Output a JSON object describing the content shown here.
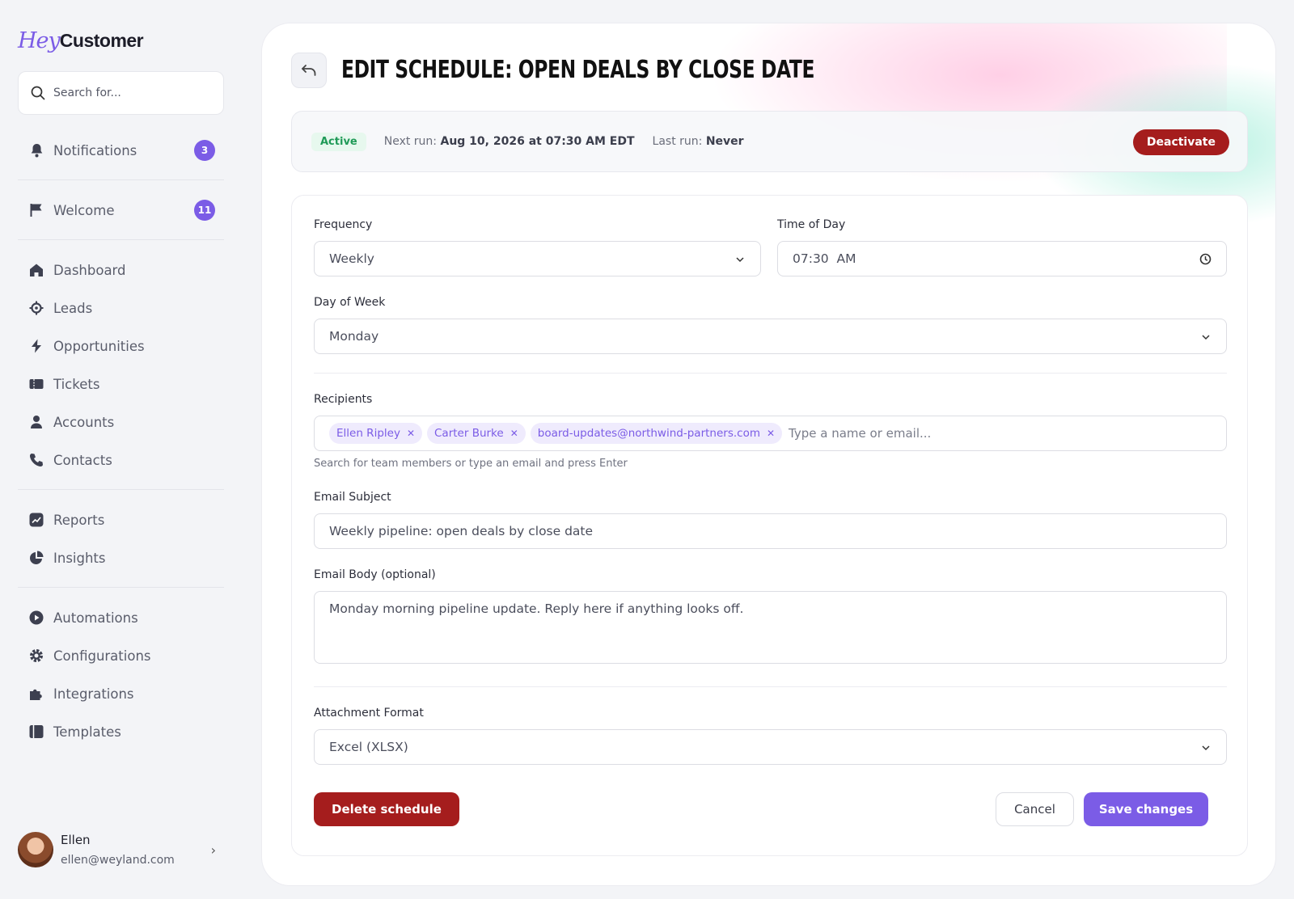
{
  "brand": {
    "logo_part1": "Hey",
    "logo_part2": "Customer"
  },
  "search": {
    "placeholder": "Search for..."
  },
  "sidebar": {
    "notifications": {
      "label": "Notifications",
      "badge": "3"
    },
    "welcome": {
      "label": "Welcome",
      "badge": "11"
    },
    "items": [
      {
        "label": "Dashboard",
        "icon": "home-icon"
      },
      {
        "label": "Leads",
        "icon": "target-icon"
      },
      {
        "label": "Opportunities",
        "icon": "bolt-icon"
      },
      {
        "label": "Tickets",
        "icon": "ticket-icon"
      },
      {
        "label": "Accounts",
        "icon": "user-icon"
      },
      {
        "label": "Contacts",
        "icon": "phone-icon"
      },
      {
        "label": "Reports",
        "icon": "chart-icon"
      },
      {
        "label": "Insights",
        "icon": "pie-icon"
      },
      {
        "label": "Automations",
        "icon": "play-icon"
      },
      {
        "label": "Configurations",
        "icon": "gear-icon"
      },
      {
        "label": "Integrations",
        "icon": "puzzle-icon"
      },
      {
        "label": "Templates",
        "icon": "template-icon"
      }
    ]
  },
  "user": {
    "name": "Ellen",
    "email": "ellen@weyland.com"
  },
  "page": {
    "title": "EDIT SCHEDULE: OPEN DEALS BY CLOSE DATE"
  },
  "status": {
    "state": "Active",
    "next_run_label": "Next run:",
    "next_run_value": "Aug 10, 2026 at 07:30 AM EDT",
    "last_run_label": "Last run:",
    "last_run_value": "Never",
    "deactivate_label": "Deactivate"
  },
  "form": {
    "frequency": {
      "label": "Frequency",
      "value": "Weekly"
    },
    "time_of_day": {
      "label": "Time of Day",
      "value": "07:30  AM"
    },
    "day_of_week": {
      "label": "Day of Week",
      "value": "Monday"
    },
    "recipients": {
      "label": "Recipients",
      "chips": [
        "Ellen Ripley",
        "Carter Burke",
        "board-updates@northwind-partners.com"
      ],
      "placeholder": "Type a name or email...",
      "hint": "Search for team members or type an email and press Enter"
    },
    "email_subject": {
      "label": "Email Subject",
      "value": "Weekly pipeline: open deals by close date"
    },
    "email_body": {
      "label": "Email Body (optional)",
      "value": "Monday morning pipeline update. Reply here if anything looks off."
    },
    "attachment_format": {
      "label": "Attachment Format",
      "value": "Excel (XLSX)"
    }
  },
  "actions": {
    "delete": "Delete schedule",
    "cancel": "Cancel",
    "save": "Save changes"
  },
  "colors": {
    "accent": "#7b5ce6",
    "danger": "#a51d1d",
    "success": "#1f9a57"
  }
}
